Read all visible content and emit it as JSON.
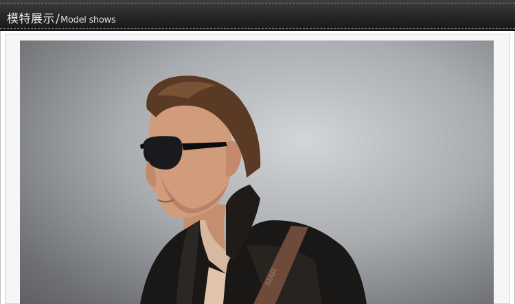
{
  "header": {
    "title_cn": "模特展示",
    "separator": "/",
    "title_en": "Model shows"
  },
  "photo": {
    "subject": "male model with aviator sunglasses and black leather jacket",
    "strap_text": "MAR"
  },
  "colors": {
    "header_bg": "#262626",
    "header_text": "#e4e4e4",
    "frame_bg": "#f6f6f6",
    "photo_bg": "#a9acb0"
  }
}
